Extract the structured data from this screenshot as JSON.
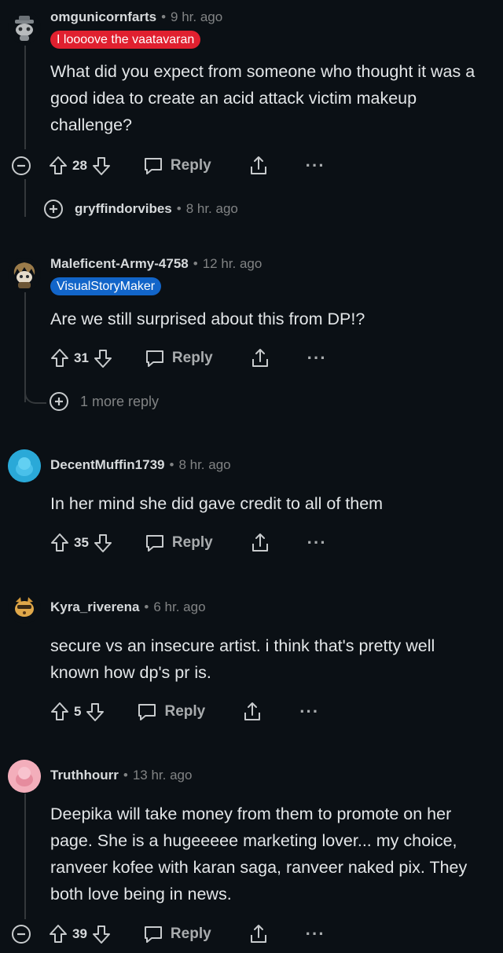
{
  "comments": [
    {
      "username": "omgunicornfarts",
      "time": "9 hr. ago",
      "flair": "I loooove the vaatavaran",
      "flair_bg": "#e0202f",
      "flair_color": "#ffffff",
      "body": "What did you expect from someone who thought it was a good idea to create an acid attack victim makeup challenge?",
      "score": "28",
      "reply_label": "Reply",
      "collapsed_reply": {
        "username": "gryffindorvibes",
        "time": "8 hr. ago"
      }
    },
    {
      "username": "Maleficent-Army-4758",
      "time": "12 hr. ago",
      "flair": "VisualStoryMaker",
      "flair_bg": "#1265c9",
      "flair_color": "#ffffff",
      "body": "Are we still surprised about this from DP!?",
      "score": "31",
      "reply_label": "Reply",
      "more_replies": "1 more reply"
    },
    {
      "username": "DecentMuffin1739",
      "time": "8 hr. ago",
      "body": "In her mind she did gave credit to all of them",
      "score": "35",
      "reply_label": "Reply"
    },
    {
      "username": "Kyra_riverena",
      "time": "6 hr. ago",
      "body": "secure vs an insecure artist. i think that's pretty well known how dp's pr is.",
      "score": "5",
      "reply_label": "Reply"
    },
    {
      "username": "Truthhourr",
      "time": "13 hr. ago",
      "body": "Deepika will take money from them to promote on her page. She is a hugeeeee marketing lover... my choice, ranveer kofee with karan saga, ranveer naked pix. They both love being in news.",
      "score": "39",
      "reply_label": "Reply"
    }
  ],
  "separator": "•",
  "more_glyph": "···",
  "colors": {
    "background": "#0b1015",
    "text": "#e3e6e8",
    "muted": "#818384",
    "thread_line": "#34383b"
  }
}
